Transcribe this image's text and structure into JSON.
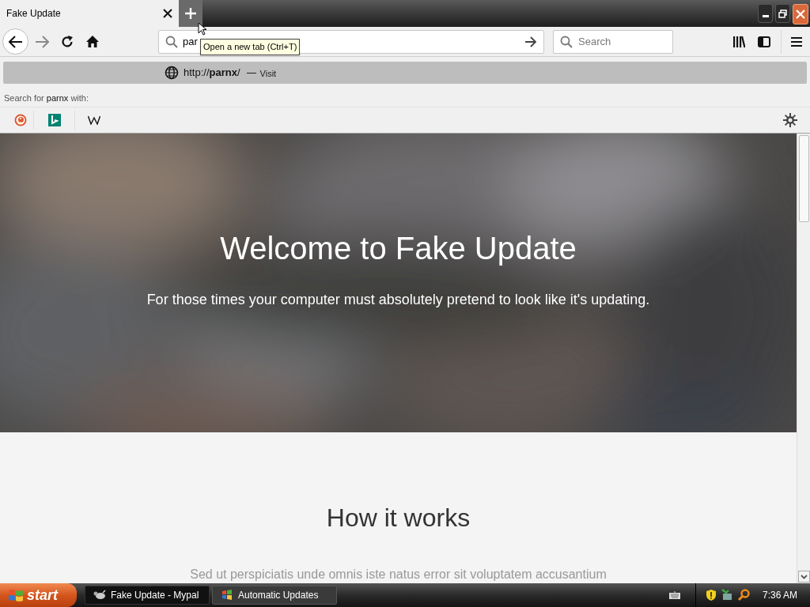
{
  "tabs": [
    {
      "title": "Fake Update",
      "selected": true
    }
  ],
  "toolbar": {
    "url_value": "par",
    "search_placeholder": "Search"
  },
  "tooltip": "Open a new tab (Ctrl+T)",
  "url_dropdown": {
    "suggestion": {
      "prefix": "http://",
      "host": "parnx",
      "suffix": "/",
      "action": "Visit"
    },
    "search_label": "Search for **parnx** with:"
  },
  "hero": {
    "title": "Welcome to Fake Update",
    "subtitle": "For those times your computer must absolutely pretend to look like it's updating."
  },
  "section": {
    "heading": "How it works",
    "text": "Sed ut perspiciatis unde omnis iste natus error sit voluptatem accusantium"
  },
  "taskbar": {
    "start": "start",
    "tasks": [
      {
        "label": "Fake Update - Mypal",
        "selected": true
      },
      {
        "label": "Automatic Updates",
        "selected": false
      }
    ],
    "clock": "7:36 AM"
  }
}
